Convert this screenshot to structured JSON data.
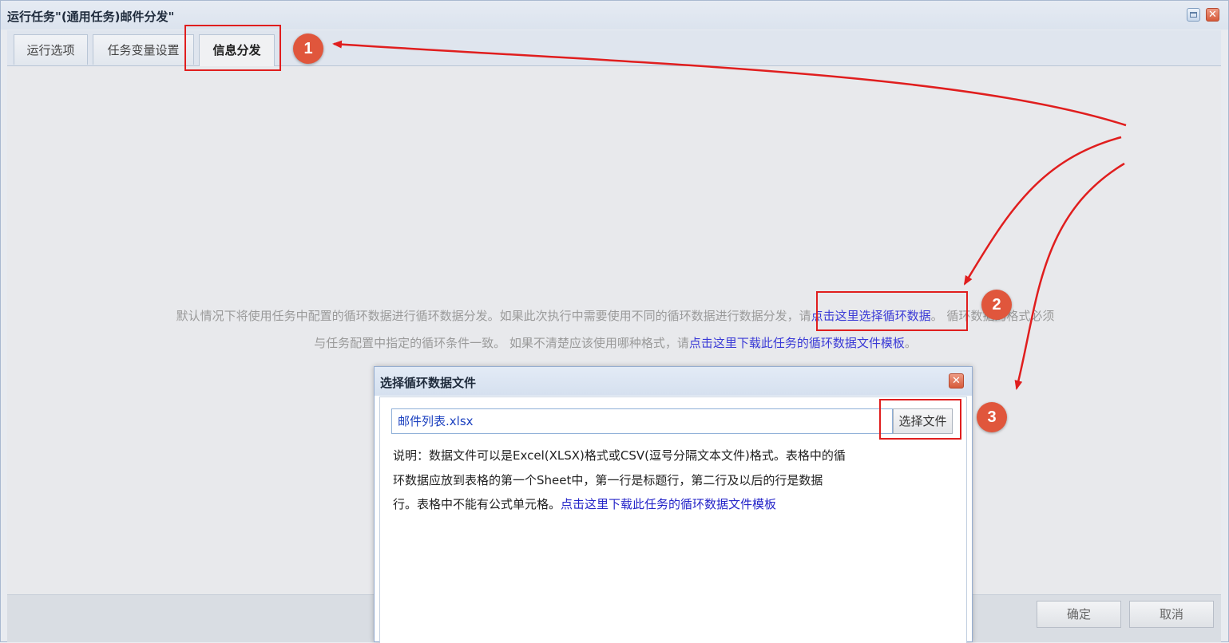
{
  "window": {
    "title": "运行任务\"(通用任务)邮件分发\"",
    "restore_icon": "window-restore-icon",
    "close_icon": "window-close-icon",
    "close_glyph": "✕"
  },
  "tabs": [
    {
      "label": "运行选项"
    },
    {
      "label": "任务变量设置"
    },
    {
      "label": "信息分发",
      "active": true
    }
  ],
  "info": {
    "line1_prefix": "默认情况下将使用任务中配置的循环数据进行循环数据分发。如果此次执行中需要使用不同的循环数据进行数据分发，请",
    "line1_link": "点击这里选择循环数据",
    "line1_suffix": "。 循环数据的格式必须",
    "line2_prefix": "与任务配置中指定的循环条件一致。 如果不清楚应该使用哪种格式，请",
    "line2_link": "点击这里下载此任务的循环数据文件模板",
    "line2_suffix": "。"
  },
  "dialog": {
    "title": "选择循环数据文件",
    "close_glyph": "✕",
    "file_value": "邮件列表.xlsx",
    "choose_button": "选择文件",
    "desc_line1": "说明：数据文件可以是Excel(XLSX)格式或CSV(逗号分隔文本文件)格式。表格中的循",
    "desc_line2": "环数据应放到表格的第一个Sheet中，第一行是标题行，第二行及以后的行是数据",
    "desc_line3_prefix": "行。表格中不能有公式单元格。",
    "desc_line3_link": "点击这里下载此任务的循环数据文件模板"
  },
  "footer": {
    "ok_button": "确定",
    "cancel_button": "取消"
  },
  "annotations": {
    "badges": [
      "1",
      "2",
      "3"
    ],
    "color": "#e01e1e",
    "badge_color": "#e0563c"
  }
}
